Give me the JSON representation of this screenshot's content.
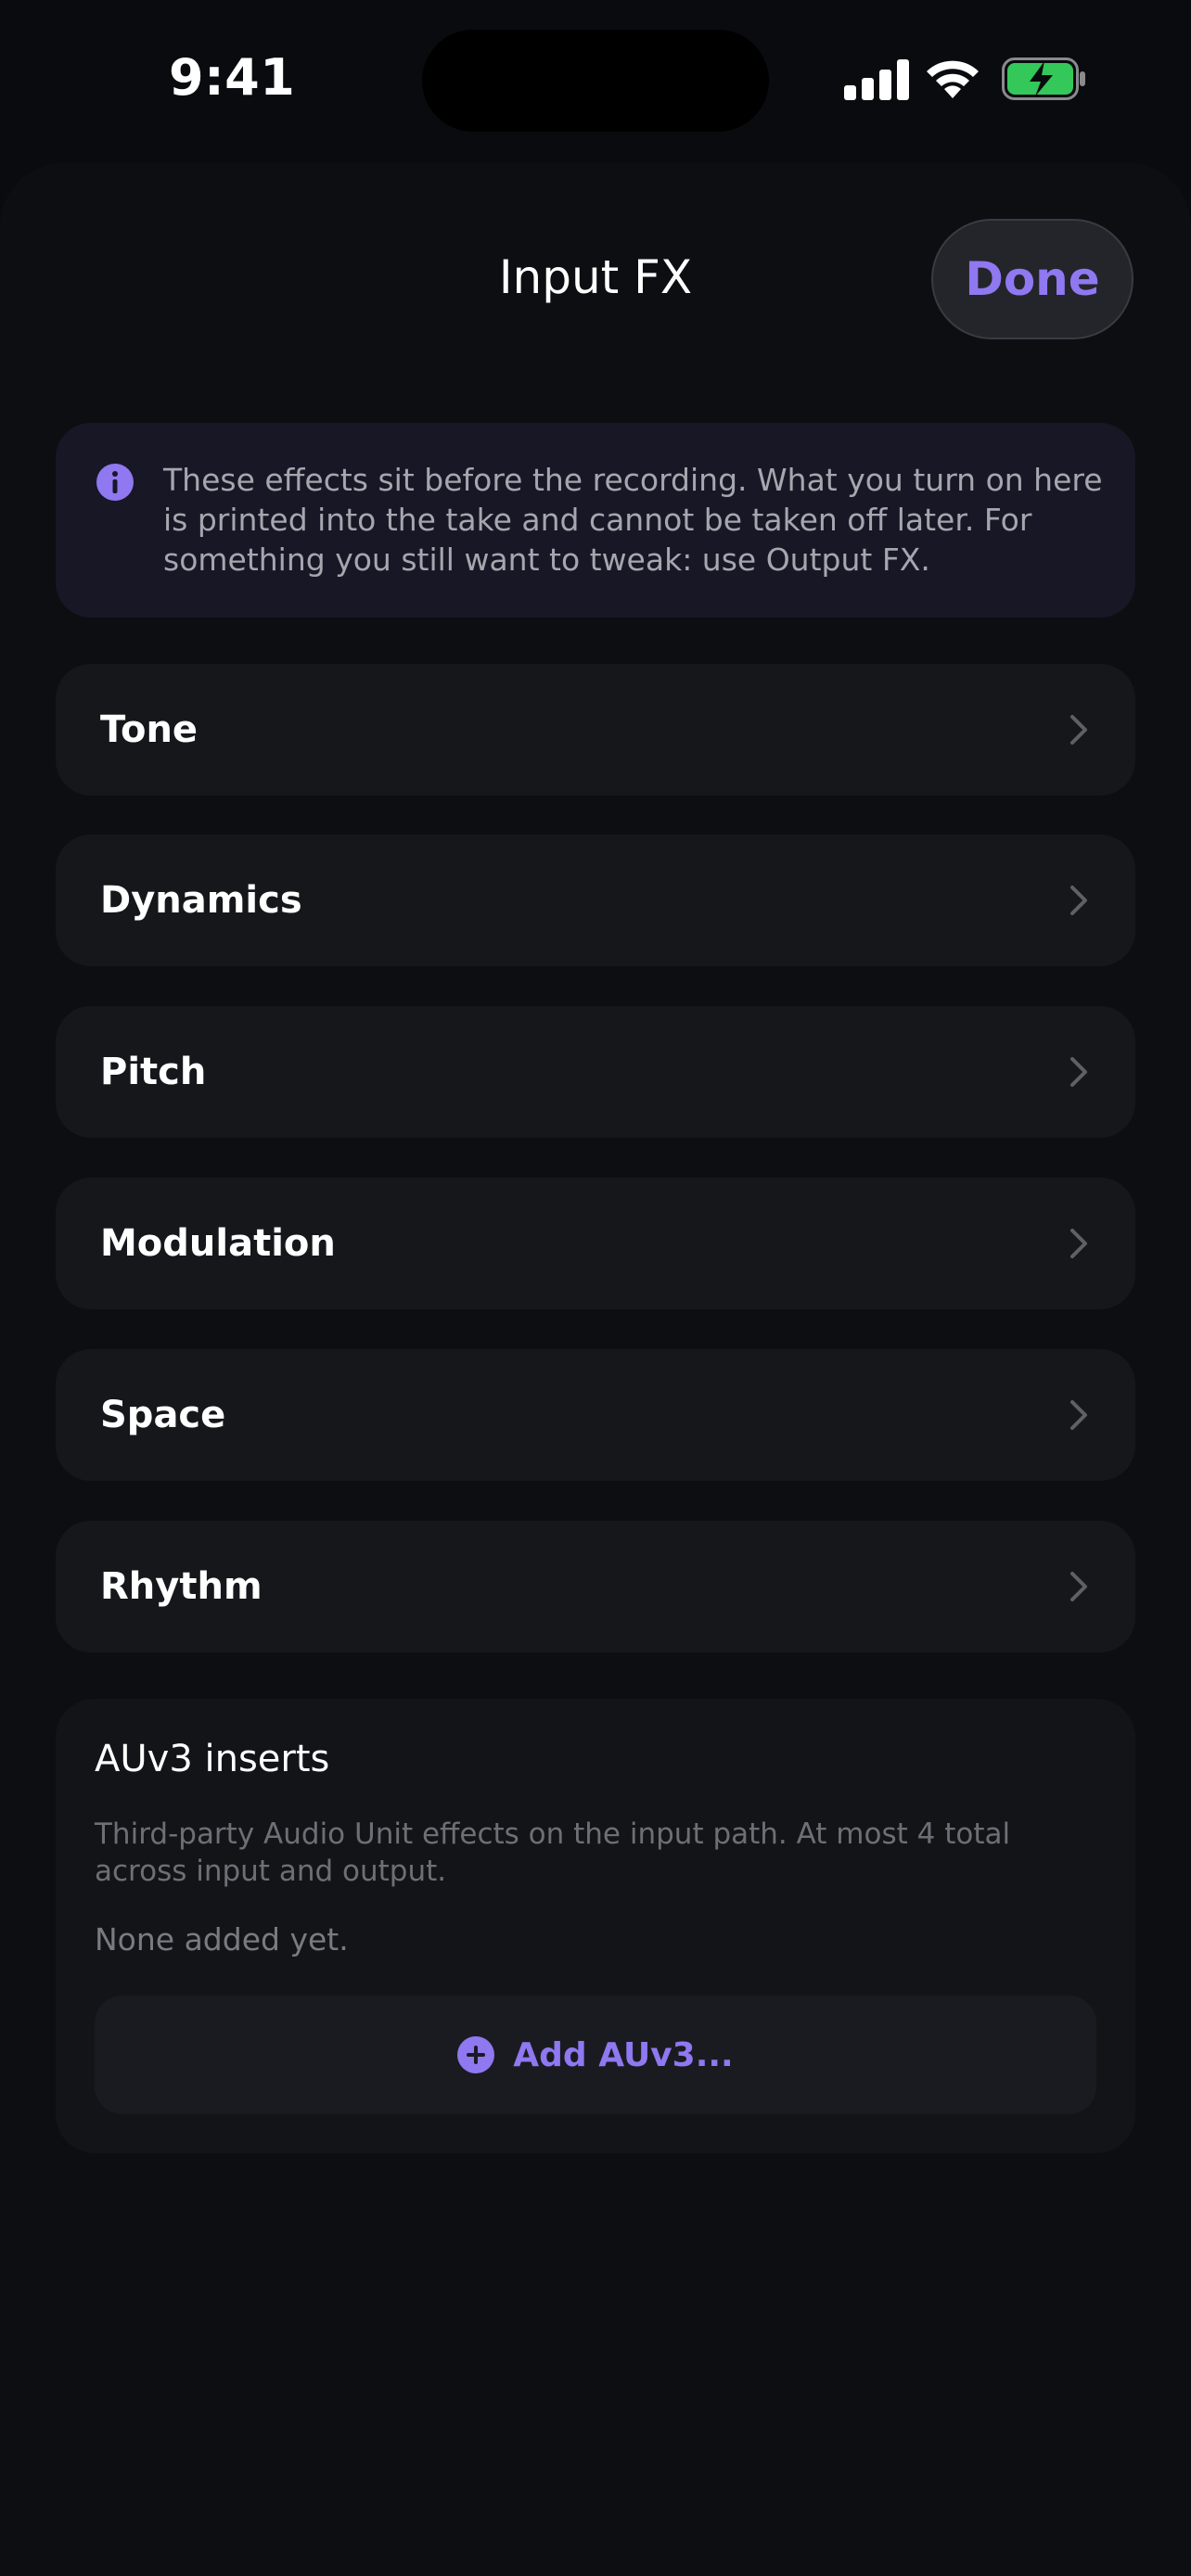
{
  "status_bar": {
    "time": "9:41",
    "icons": [
      "cellular-signal-icon",
      "wifi-icon",
      "battery-charging-icon"
    ],
    "battery_color": "#34c759"
  },
  "header": {
    "title": "Input FX",
    "done_label": "Done"
  },
  "info": {
    "icon": "info-icon",
    "text": "These effects sit before the recording. What you turn on here is printed into the take and cannot be taken off later. For something you still want to tweak: use Output FX."
  },
  "categories": [
    {
      "label": "Tone"
    },
    {
      "label": "Dynamics"
    },
    {
      "label": "Pitch"
    },
    {
      "label": "Modulation"
    },
    {
      "label": "Space"
    },
    {
      "label": "Rhythm"
    }
  ],
  "auv3": {
    "title": "AUv3 inserts",
    "description": "Third-party Audio Unit effects on the input path. At most 4 total across input and output.",
    "empty_text": "None added yet.",
    "add_label": "Add AUv3..."
  },
  "colors": {
    "accent": "#8f78f0",
    "background": "#0a0b0e",
    "card": "#16171b"
  }
}
